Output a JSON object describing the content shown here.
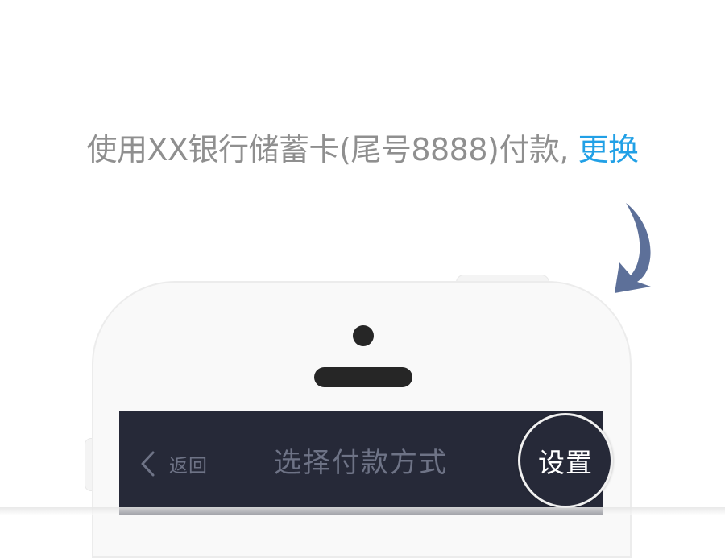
{
  "payment_line": {
    "text": "使用XX银行储蓄卡(尾号8888)付款, ",
    "change_link": "更换"
  },
  "icons": {
    "arrow": "curved-arrow-down-icon",
    "back": "chevron-left-icon"
  },
  "phone": {
    "nav": {
      "back_label": "返回",
      "title": "选择付款方式",
      "settings_label": "设置"
    }
  },
  "colors": {
    "link": "#21a0e6",
    "nav_background": "#262938",
    "arrow": "#5d7099",
    "muted_text": "#8f8f8f"
  }
}
